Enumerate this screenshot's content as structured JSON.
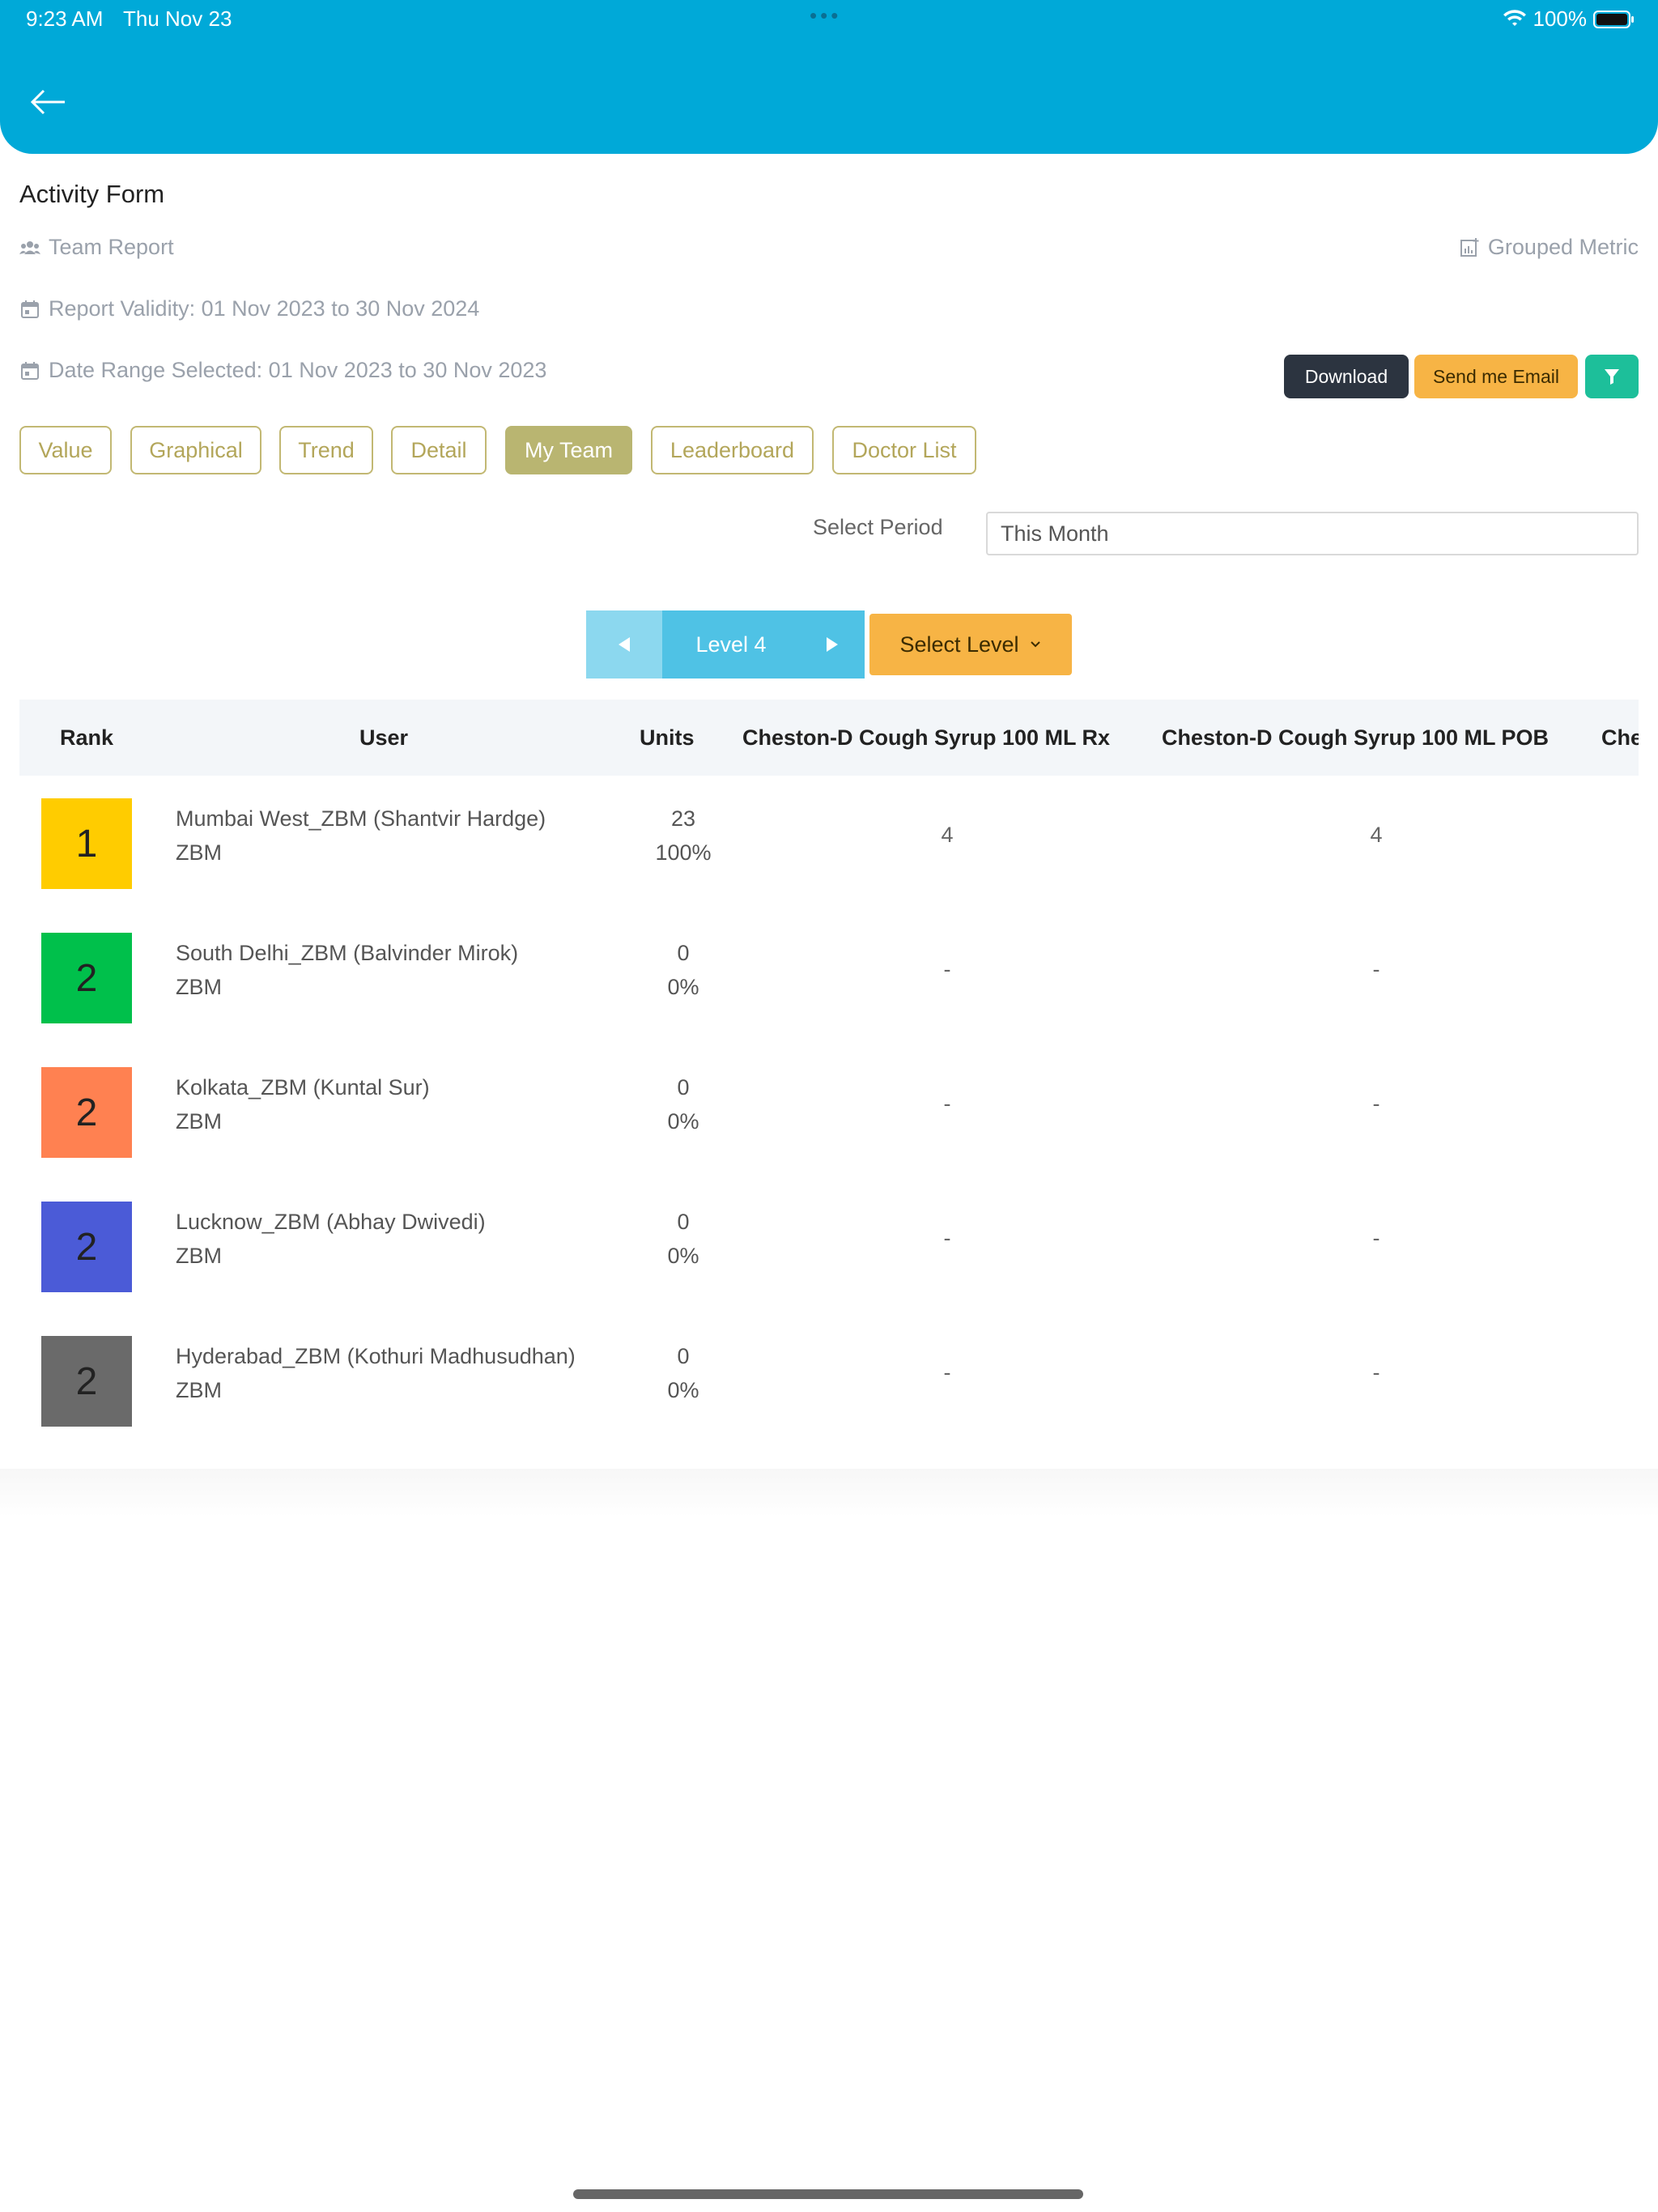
{
  "status_bar": {
    "time": "9:23 AM",
    "date": "Thu Nov 23",
    "dots": "•••",
    "battery": "100%"
  },
  "header": {
    "title": "Activity Form"
  },
  "meta": {
    "team_report": "Team Report",
    "grouped_metric": "Grouped Metric",
    "validity": "Report Validity: 01 Nov 2023 to 30 Nov 2024",
    "date_range": "Date Range Selected: 01 Nov 2023 to 30 Nov 2023"
  },
  "actions": {
    "download": "Download",
    "email": "Send me Email"
  },
  "tabs": [
    {
      "label": "Value"
    },
    {
      "label": "Graphical"
    },
    {
      "label": "Trend"
    },
    {
      "label": "Detail"
    },
    {
      "label": "My Team"
    },
    {
      "label": "Leaderboard"
    },
    {
      "label": "Doctor List"
    }
  ],
  "period": {
    "label": "Select Period",
    "value": "This Month"
  },
  "level": {
    "current": "Level 4",
    "select_label": "Select Level"
  },
  "table": {
    "headers": [
      "Rank",
      "User",
      "Units",
      "Cheston-D Cough Syrup 100 ML Rx",
      "Cheston-D Cough Syrup 100 ML POB",
      "Che"
    ],
    "rows": [
      {
        "rank": "1",
        "color": "#ffcc00",
        "name": "Mumbai West_ZBM (Shantvir Hardge)",
        "role": "ZBM",
        "units": "23",
        "pct": "100%",
        "rx": "4",
        "pob": "4"
      },
      {
        "rank": "2",
        "color": "#00c04b",
        "name": "South Delhi_ZBM (Balvinder Mirok)",
        "role": "ZBM",
        "units": "0",
        "pct": "0%",
        "rx": "-",
        "pob": "-"
      },
      {
        "rank": "2",
        "color": "#ff8151",
        "name": "Kolkata_ZBM (Kuntal Sur)",
        "role": "ZBM",
        "units": "0",
        "pct": "0%",
        "rx": "-",
        "pob": "-"
      },
      {
        "rank": "2",
        "color": "#4b5bd7",
        "name": "Lucknow_ZBM (Abhay Dwivedi)",
        "role": "ZBM",
        "units": "0",
        "pct": "0%",
        "rx": "-",
        "pob": "-"
      },
      {
        "rank": "2",
        "color": "#6a6a6a",
        "name": "Hyderabad_ZBM (Kothuri Madhusudhan)",
        "role": "ZBM",
        "units": "0",
        "pct": "0%",
        "rx": "-",
        "pob": "-"
      }
    ]
  }
}
